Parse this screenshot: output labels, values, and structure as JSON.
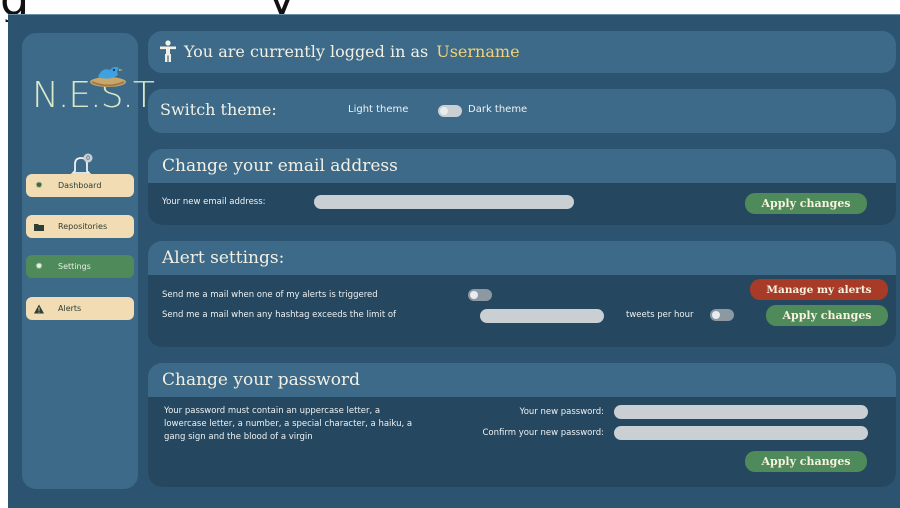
{
  "top_fragment": {
    "left": "g",
    "right": "y"
  },
  "sidebar": {
    "logo_text": "N.E.S.T.",
    "items": [
      {
        "label": "Dashboard",
        "icon": "gear-icon"
      },
      {
        "label": "Repositories",
        "icon": "folder-icon"
      },
      {
        "label": "Settings",
        "icon": "gear-icon"
      },
      {
        "label": "Alerts",
        "icon": "warning-icon"
      }
    ]
  },
  "login": {
    "prefix": "You are currently logged in as",
    "username": "Username"
  },
  "theme": {
    "title": "Switch theme:",
    "light_label": "Light theme",
    "dark_label": "Dark theme"
  },
  "email": {
    "title": "Change your email address",
    "field_label": "Your new email address:",
    "apply": "Apply changes"
  },
  "alerts": {
    "title": "Alert settings:",
    "option1": "Send me a mail when one of my alerts is triggered",
    "option2_prefix": "Send me a mail when any hashtag exceeds the limit of",
    "option2_suffix": "tweets per hour",
    "manage": "Manage my alerts",
    "apply": "Apply changes"
  },
  "password": {
    "title": "Change your password",
    "hint": "Your password must contain an uppercase letter, a lowercase letter, a number, a special character, a haiku, a gang sign and the blood of a virgin",
    "new_label": "Your new password:",
    "confirm_label": "Confirm your new password:",
    "apply": "Apply changes"
  },
  "colors": {
    "background": "#2c5470",
    "card": "#3d6a89",
    "card_body": "#25475f",
    "accent_green": "#4e8a5a",
    "accent_red": "#a83a28",
    "cream": "#f2dcb3",
    "username": "#f0d27a"
  }
}
